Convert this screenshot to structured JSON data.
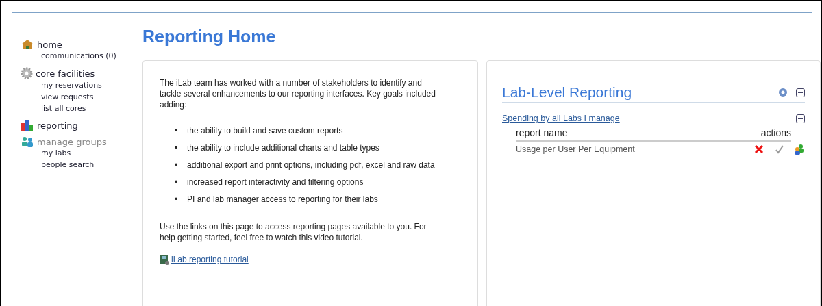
{
  "sidebar": {
    "sections": [
      {
        "label": "home",
        "kind": "home",
        "disabled": false,
        "items": [
          "communications (0)"
        ]
      },
      {
        "label": "core facilities",
        "kind": "gear",
        "disabled": false,
        "items": [
          "my reservations",
          "view requests",
          "list all cores"
        ]
      },
      {
        "label": "reporting",
        "kind": "chart",
        "disabled": false
      },
      {
        "label": "manage groups",
        "kind": "people",
        "disabled": true,
        "items": [
          "my labs",
          "people search"
        ]
      }
    ]
  },
  "page_title": "Reporting Home",
  "intro": {
    "paragraph": "The iLab team has worked with a number of stakeholders to identify and tackle several enhancements to our reporting interfaces. Key goals included adding:",
    "goals": [
      {
        "marker": "•",
        "text": "the ability to build and save custom reports"
      },
      {
        "marker": "•",
        "text": "the ability to include additional charts and table types"
      },
      {
        "marker": "•",
        "text": "additional export and print options, including pdf, excel and raw data"
      },
      {
        "marker": "•",
        "text": "increased report interactivity and filtering options"
      },
      {
        "marker": "•",
        "text": "PI and lab manager access to reporting for their labs"
      }
    ],
    "closing": "Use the links on this page to access reporting pages available to you. For help getting started, feel free to watch this video tutorial.",
    "tutorial_link": "iLab reporting tutorial"
  },
  "lab_reporting": {
    "title": "Lab-Level Reporting",
    "group": {
      "label": "Spending by all Labs I manage",
      "expanded": true,
      "columns": [
        "report name",
        "actions"
      ],
      "rows": [
        {
          "name": "Usage per User Per Equipment"
        }
      ]
    }
  }
}
